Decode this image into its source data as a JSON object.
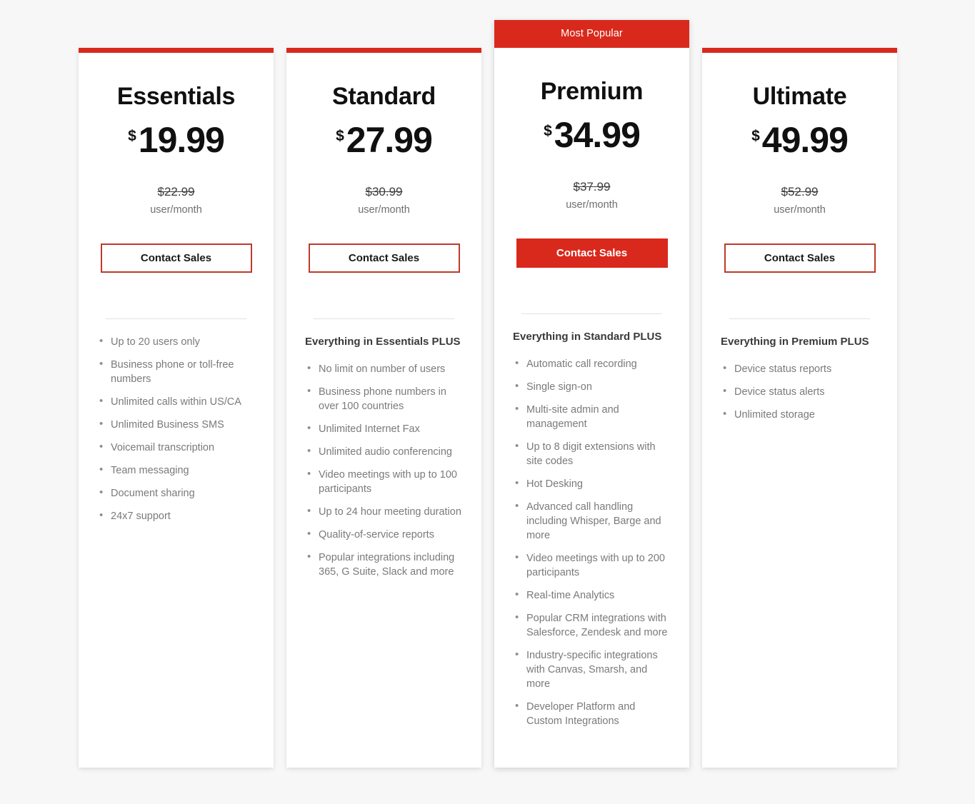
{
  "theme": {
    "accent_color": "#d9291c",
    "background_color": "#f7f7f7",
    "card_background": "#ffffff",
    "feature_text_color": "#7a7a7a"
  },
  "plans": [
    {
      "name": "Essentials",
      "currency": "$",
      "price": "19.99",
      "old_price": "$22.99",
      "per_unit": "user/month",
      "cta_label": "Contact Sales",
      "cta_style": "outline",
      "badge": null,
      "features_heading": null,
      "features": [
        "Up to 20 users only",
        "Business phone or toll-free numbers",
        "Unlimited calls within US/CA",
        "Unlimited Business SMS",
        "Voicemail transcription",
        "Team messaging",
        "Document sharing",
        "24x7 support"
      ]
    },
    {
      "name": "Standard",
      "currency": "$",
      "price": "27.99",
      "old_price": "$30.99",
      "per_unit": "user/month",
      "cta_label": "Contact Sales",
      "cta_style": "outline",
      "badge": null,
      "features_heading": "Everything in Essentials PLUS",
      "features": [
        "No limit on number of users",
        "Business phone numbers in over 100 countries",
        "Unlimited Internet Fax",
        "Unlimited audio conferencing",
        "Video meetings with up to 100 participants",
        "Up to 24 hour meeting duration",
        "Quality-of-service reports",
        "Popular integrations including 365, G Suite, Slack and more"
      ]
    },
    {
      "name": "Premium",
      "currency": "$",
      "price": "34.99",
      "old_price": "$37.99",
      "per_unit": "user/month",
      "cta_label": "Contact Sales",
      "cta_style": "solid",
      "badge": "Most Popular",
      "features_heading": "Everything in Standard PLUS",
      "features": [
        "Automatic call recording",
        "Single sign-on",
        "Multi-site admin and management",
        "Up to 8 digit extensions with site codes",
        "Hot Desking",
        "Advanced call handling including Whisper, Barge and more",
        "Video meetings with up to 200 participants",
        "Real-time Analytics",
        "Popular CRM integrations with Salesforce, Zendesk and more",
        "Industry-specific integrations with Canvas, Smarsh, and more",
        "Developer Platform and Custom Integrations"
      ]
    },
    {
      "name": "Ultimate",
      "currency": "$",
      "price": "49.99",
      "old_price": "$52.99",
      "per_unit": "user/month",
      "cta_label": "Contact Sales",
      "cta_style": "outline",
      "badge": null,
      "features_heading": "Everything in Premium PLUS",
      "features": [
        "Device status reports",
        "Device status alerts",
        "Unlimited storage"
      ]
    }
  ]
}
